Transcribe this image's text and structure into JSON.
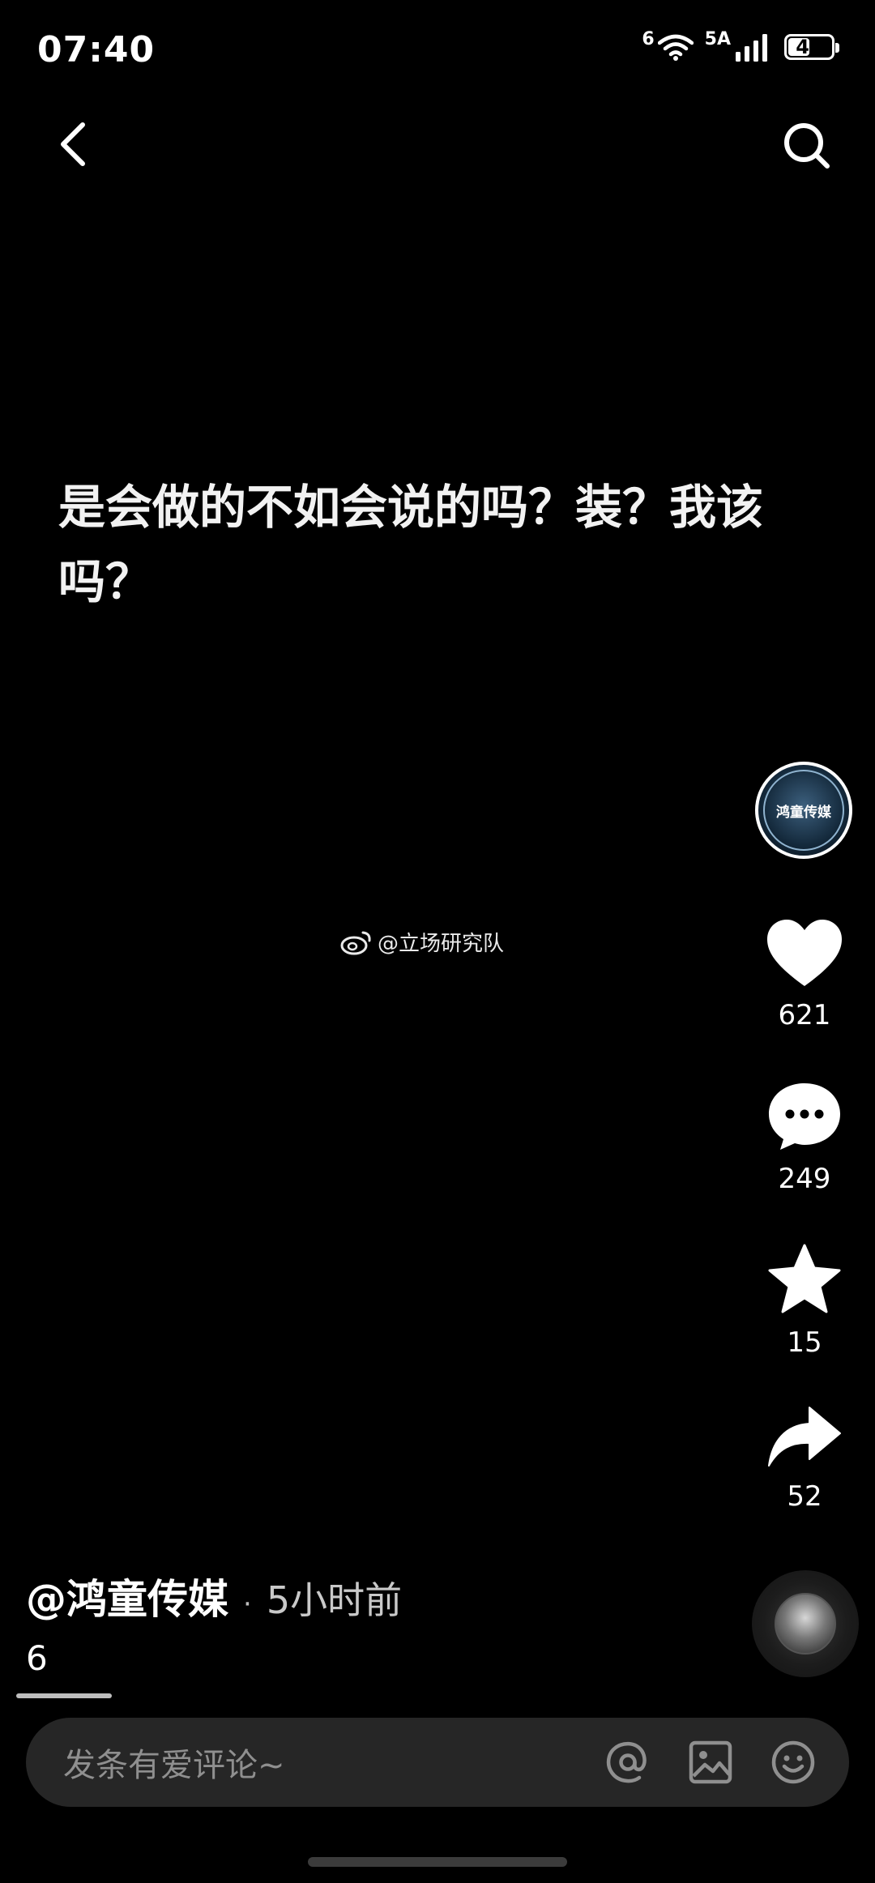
{
  "status_bar": {
    "time": "07:40",
    "network": "5A",
    "wifi_badge": "6",
    "battery": "41"
  },
  "header": {
    "back_icon": "chevron-left-icon",
    "search_icon": "search-icon"
  },
  "post": {
    "text": "是会做的不如会说的吗？装？我该吗？",
    "watermark": "@立场研究队"
  },
  "actions": {
    "avatar_label": "鸿童传媒",
    "like_count": "621",
    "comment_count": "249",
    "favorite_count": "15",
    "share_count": "52"
  },
  "meta": {
    "author": "@鸿童传媒",
    "separator": "·",
    "time_ago": "5小时前",
    "caption": "6"
  },
  "comment_bar": {
    "placeholder": "发条有爱评论~",
    "icons": [
      "at-icon",
      "image-icon",
      "emoji-icon"
    ]
  }
}
